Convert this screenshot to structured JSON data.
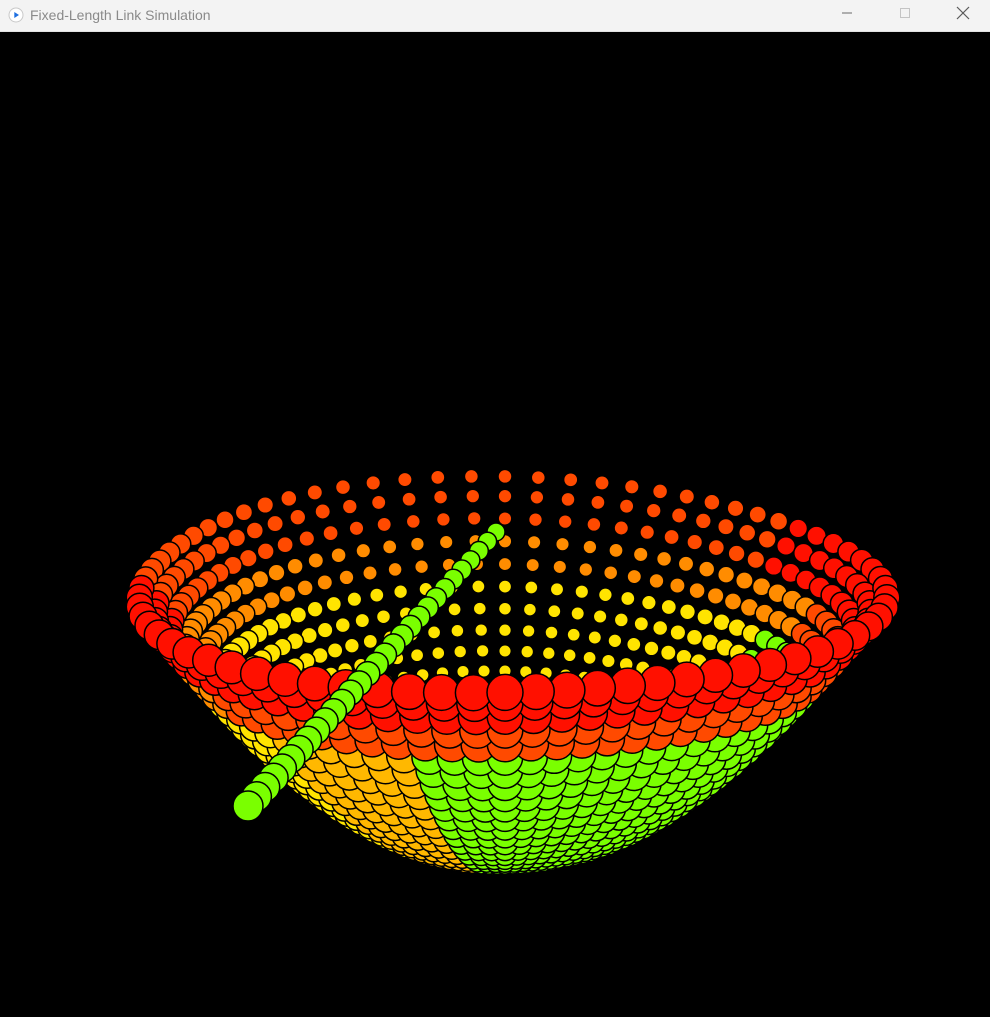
{
  "window": {
    "title": "Fixed-Length Link Simulation",
    "controls": [
      "minimize",
      "maximize",
      "close"
    ]
  },
  "canvas": {
    "background": "#000000",
    "ball_outline": "#000000",
    "colors": {
      "red": "#ff1000",
      "red_orange": "#ff4a00",
      "orange": "#ff8c00",
      "amber": "#ffb800",
      "yellow": "#ffe400",
      "green": "#7aff00"
    }
  }
}
